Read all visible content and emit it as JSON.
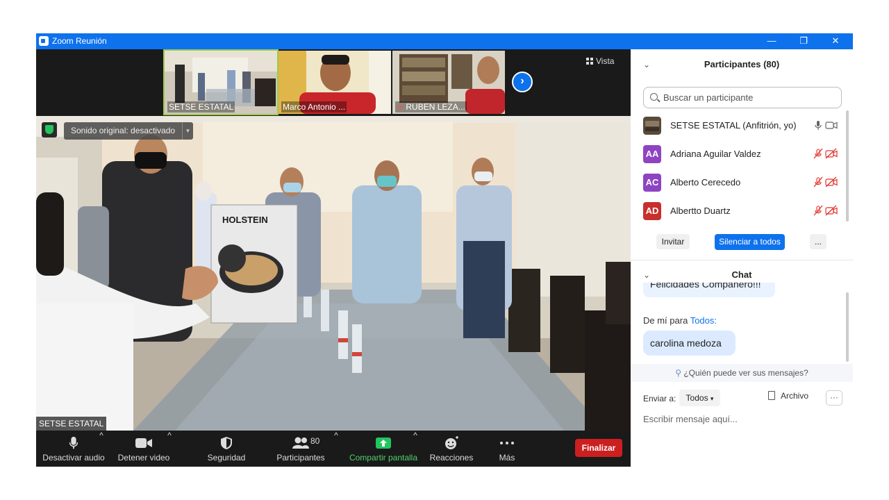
{
  "titlebar": {
    "title": "Zoom Reunión",
    "minimize": "—",
    "restore": "❐",
    "close": "✕"
  },
  "thumbnails": [
    {
      "label": "SETSE ESTATAL"
    },
    {
      "label": "Marco Antonio ..."
    },
    {
      "label": "RUBEN LEZA..."
    }
  ],
  "view_button": "Vista",
  "main_video": {
    "sound_pill": "Sonido original: desactivado",
    "speaker_label": "SETSE ESTATAL",
    "product_box_text": "HOLSTEIN"
  },
  "toolbar": {
    "audio": "Desactivar audio",
    "video": "Detener video",
    "security": "Seguridad",
    "participants": "Participantes",
    "participants_count": "80",
    "share": "Compartir pantalla",
    "reactions": "Reacciones",
    "more": "Más",
    "end": "Finalizar"
  },
  "participants_panel": {
    "title": "Participantes (80)",
    "search_placeholder": "Buscar un participante",
    "rows": [
      {
        "initials": "",
        "name": "SETSE ESTATAL (Anfitrión, yo)",
        "color": "#5a4a3a"
      },
      {
        "initials": "AA",
        "name": "Adriana Aguilar Valdez",
        "color": "#8e44c2"
      },
      {
        "initials": "AC",
        "name": "Alberto Cerecedo",
        "color": "#8e44c2"
      },
      {
        "initials": "AD",
        "name": "Albertto Duartz",
        "color": "#c7302d"
      }
    ],
    "invite": "Invitar",
    "mute_all": "Silenciar a todos",
    "more": "..."
  },
  "chat_panel": {
    "title": "Chat",
    "prev_message": "Felicidades Compañero!!!",
    "from_prefix": "De mí para",
    "from_to": "Todos:",
    "last_message": "carolina medoza",
    "who_sees": "¿Quién puede ver sus mensajes?",
    "send_to_label": "Enviar a:",
    "send_to_value": "Todos",
    "file": "Archivo",
    "more": "···",
    "input_placeholder": "Escribir mensaje aquí..."
  },
  "colors": {
    "accent": "#0e72ed",
    "end_red": "#cc1f1f",
    "share_green": "#22c55e",
    "muted_red": "#e0302b"
  }
}
